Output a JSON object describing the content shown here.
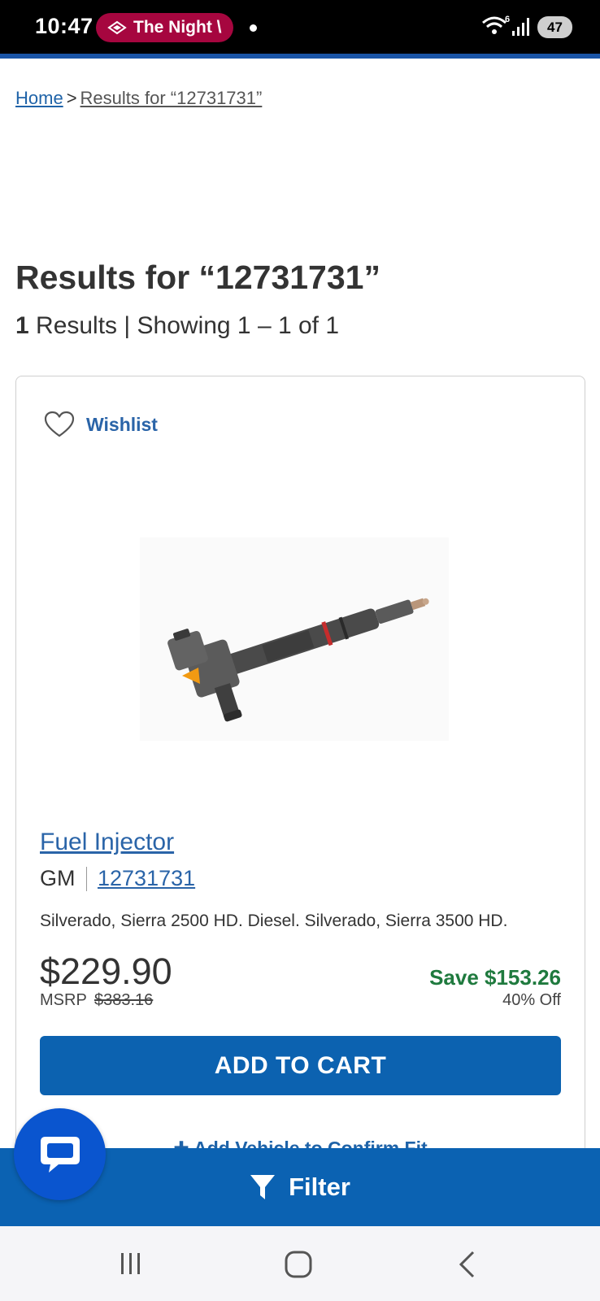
{
  "status_bar": {
    "time": "10:47",
    "notification": "The Night \\",
    "network_label": "6",
    "battery": "47"
  },
  "breadcrumb": {
    "home": "Home",
    "separator": ">",
    "current": "Results for “12731731”"
  },
  "page": {
    "title": "Results for “12731731”",
    "result_count": "1",
    "result_text": " Results | Showing 1 – 1 of 1"
  },
  "product": {
    "wishlist_label": "Wishlist",
    "name": "Fuel Injector",
    "brand": "GM",
    "part_number": "12731731",
    "fitment": "Silverado, Sierra 2500 HD. Diesel. Silverado, Sierra 3500 HD.",
    "price": "$229.90",
    "msrp_label": "MSRP",
    "msrp_value": "$383.16",
    "save": "Save $153.26",
    "discount": "40% Off",
    "add_to_cart": "ADD TO CART",
    "add_vehicle": "Add Vehicle to Confirm Fit"
  },
  "filter_bar": {
    "label": "Filter"
  },
  "colors": {
    "link_blue": "#2a64a8",
    "cta_blue": "#0c62b0",
    "save_green": "#1f7a3e",
    "status_pill": "#a6063f"
  },
  "icons": [
    "heart-icon",
    "filter-icon",
    "chat-icon",
    "wifi-icon",
    "signal-icon",
    "recent-apps-icon",
    "home-icon",
    "back-icon"
  ]
}
